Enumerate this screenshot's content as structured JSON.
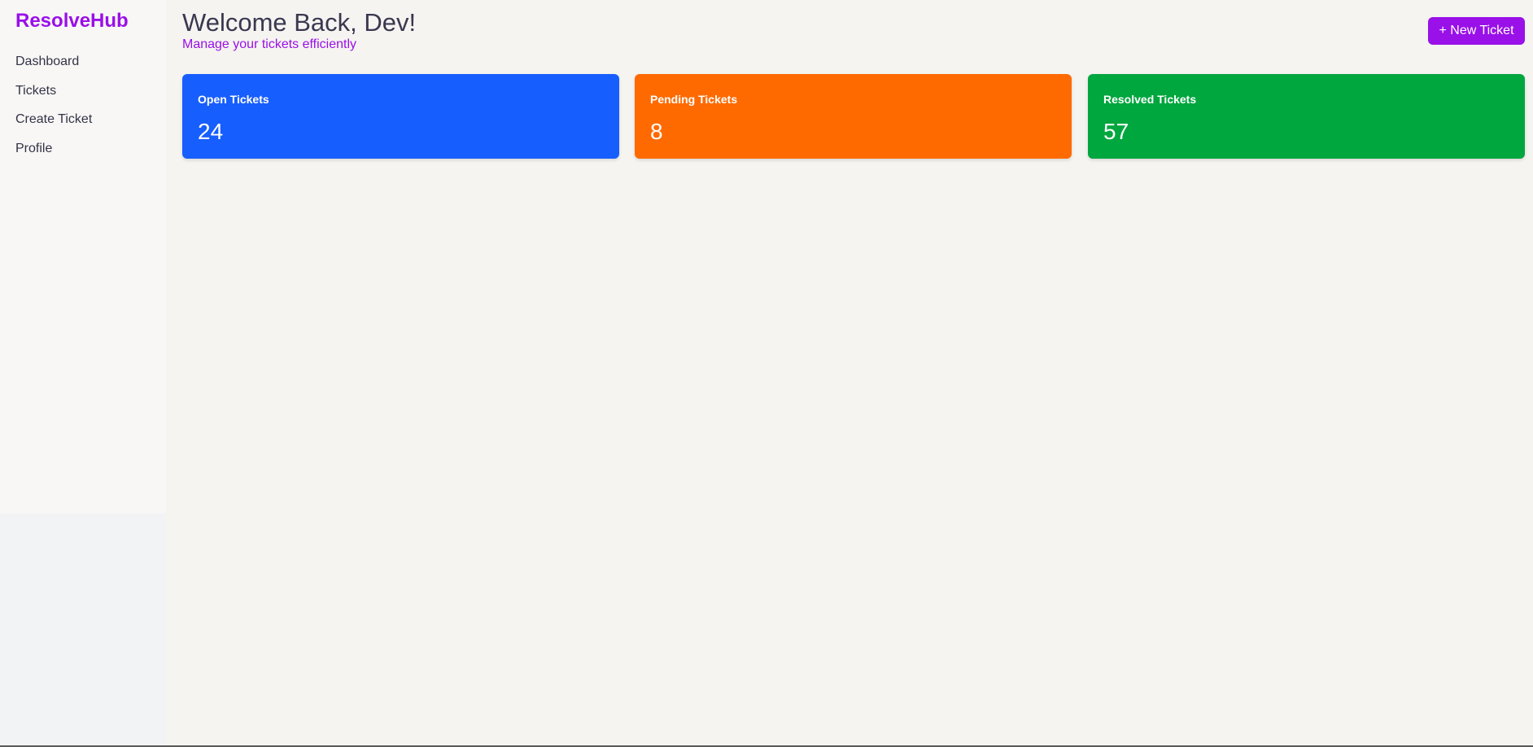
{
  "sidebar": {
    "brand": "ResolveHub",
    "items": [
      {
        "label": "Dashboard"
      },
      {
        "label": "Tickets"
      },
      {
        "label": "Create Ticket"
      },
      {
        "label": "Profile"
      }
    ]
  },
  "header": {
    "title": "Welcome Back, Dev!",
    "subtitle": "Manage your tickets efficiently",
    "new_ticket_label": "+ New Ticket"
  },
  "stats": [
    {
      "label": "Open Tickets",
      "value": "24",
      "color": "#175efe"
    },
    {
      "label": "Pending Tickets",
      "value": "8",
      "color": "#ff6a00"
    },
    {
      "label": "Resolved Tickets",
      "value": "57",
      "color": "#00a63e"
    }
  ],
  "colors": {
    "accent": "#9910e8",
    "sidebar_bg": "#f8f7f5",
    "main_bg": "#f5f4f1",
    "text": "#333347"
  }
}
